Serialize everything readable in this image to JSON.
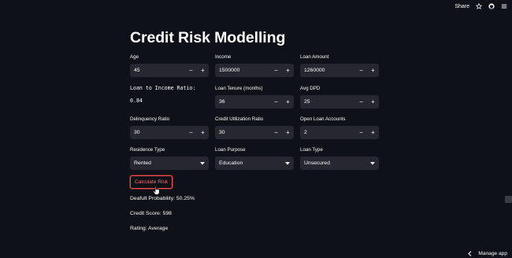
{
  "topbar": {
    "share_label": "Share",
    "icons": [
      "star-icon",
      "github-icon",
      "menu-icon"
    ]
  },
  "title": "Credit Risk Modelling",
  "fields": {
    "age": {
      "label": "Age",
      "value": "45"
    },
    "income": {
      "label": "Income",
      "value": "1500000"
    },
    "loan_amount": {
      "label": "Loan Amount",
      "value": "1260000"
    },
    "lti": {
      "label": "Loan to Income Ratio:",
      "value": "0.84"
    },
    "loan_tenure": {
      "label": "Loan Tenure (months)",
      "value": "36"
    },
    "avg_dpd": {
      "label": "Avg DPD",
      "value": "25"
    },
    "delinquency": {
      "label": "Delinquency Ratio",
      "value": "30"
    },
    "credit_util": {
      "label": "Credit Utilization Ratio",
      "value": "30"
    },
    "open_loans": {
      "label": "Open Loan Accounts",
      "value": "2"
    },
    "residence": {
      "label": "Residence Type",
      "value": "Rented"
    },
    "purpose": {
      "label": "Loan Purpose",
      "value": "Education"
    },
    "loan_type": {
      "label": "Loan Type",
      "value": "Unsecured"
    }
  },
  "stepper": {
    "minus": "−",
    "plus": "+"
  },
  "button": {
    "calculate": "Calculate Risk"
  },
  "results": {
    "probability": "Deafult Probability: 50.25%",
    "credit_score": "Credit Score: 598",
    "rating": "Rating: Average"
  },
  "footer": {
    "manage_app": "Manage app"
  },
  "colors": {
    "background": "#0e1117",
    "input_bg": "#262730",
    "accent": "#ff4b4b"
  }
}
